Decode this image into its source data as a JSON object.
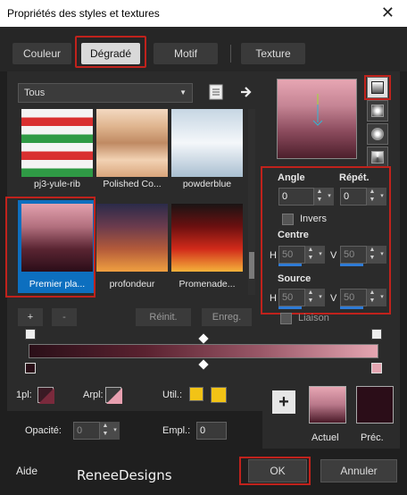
{
  "window": {
    "title": "Propriétés des styles et textures",
    "close_glyph": "✕"
  },
  "tabs": [
    {
      "label": "Couleur"
    },
    {
      "label": "Dégradé"
    },
    {
      "label": "Motif"
    },
    {
      "label": "Texture"
    }
  ],
  "library": {
    "dropdown_value": "Tous",
    "thumbnails": [
      {
        "caption": "pj3-yule-rib",
        "colors": [
          "#f4f4f4",
          "#d93030",
          "#f4f4f4",
          "#2f9a45",
          "#f4f4f4",
          "#d93030",
          "#f4f4f4",
          "#2f9a45"
        ]
      },
      {
        "caption": "Polished Co...",
        "colors": [
          "#f3d9c1",
          "#e0b690",
          "#c08a63",
          "#f2d2b3",
          "#d9a57c"
        ]
      },
      {
        "caption": "powderblue",
        "colors": [
          "#c6d6e3",
          "#f4f7fa",
          "#a9bfd1"
        ]
      },
      {
        "caption": "Premier pla...",
        "colors": [
          "#e2a1ad",
          "#b3707f",
          "#5a2532",
          "#2b0d18"
        ]
      },
      {
        "caption": "profondeur",
        "colors": [
          "#2b2b4a",
          "#6b3b4d",
          "#b35a3a",
          "#f0a040"
        ]
      },
      {
        "caption": "Promenade...",
        "colors": [
          "#1a1414",
          "#6b1010",
          "#d12a1a",
          "#f5b23a"
        ]
      }
    ],
    "add_label": "+",
    "remove_label": "-",
    "reset_label": "Réinit.",
    "save_label": "Enreg."
  },
  "preview": {
    "colors": [
      "#e7a6b3",
      "#c58494",
      "#8a4a5c",
      "#4d1f2c"
    ]
  },
  "params": {
    "angle_label": "Angle",
    "angle_value": "0",
    "repeat_label": "Répét.",
    "repeat_value": "0",
    "invert_label": "Invers",
    "center_label": "Centre",
    "center_h_label": "H",
    "center_h_value": "50",
    "center_v_label": "V",
    "center_v_value": "50",
    "source_label": "Source",
    "source_h_label": "H",
    "source_h_value": "50",
    "source_v_label": "V",
    "source_v_value": "50",
    "link_label": "Liaison"
  },
  "editor": {
    "bar_colors": [
      "#2a0f18",
      "#5a2230",
      "#9a5868",
      "#e5a6b2"
    ],
    "fg_label": "1pl:",
    "bg_label": "Arpl:",
    "user_label": "Util.:",
    "user_colors": [
      "#f2c316",
      "#f2c316"
    ],
    "opacity_label": "Opacité:",
    "opacity_value": "0",
    "location_label": "Empl.:",
    "location_value": "0",
    "fg_swatch": "#3a1a24",
    "bg_swatch": "#e8a0b0"
  },
  "current": {
    "add_glyph": "+",
    "actual_label": "Actuel",
    "previous_label": "Préc.",
    "actual_colors": [
      "#e7a6b3",
      "#b9788a",
      "#4a1a28"
    ],
    "previous_color": "#2b0d18"
  },
  "footer": {
    "help_label": "Aide",
    "watermark": "ReneeDesigns",
    "ok_label": "OK",
    "cancel_label": "Annuler"
  }
}
